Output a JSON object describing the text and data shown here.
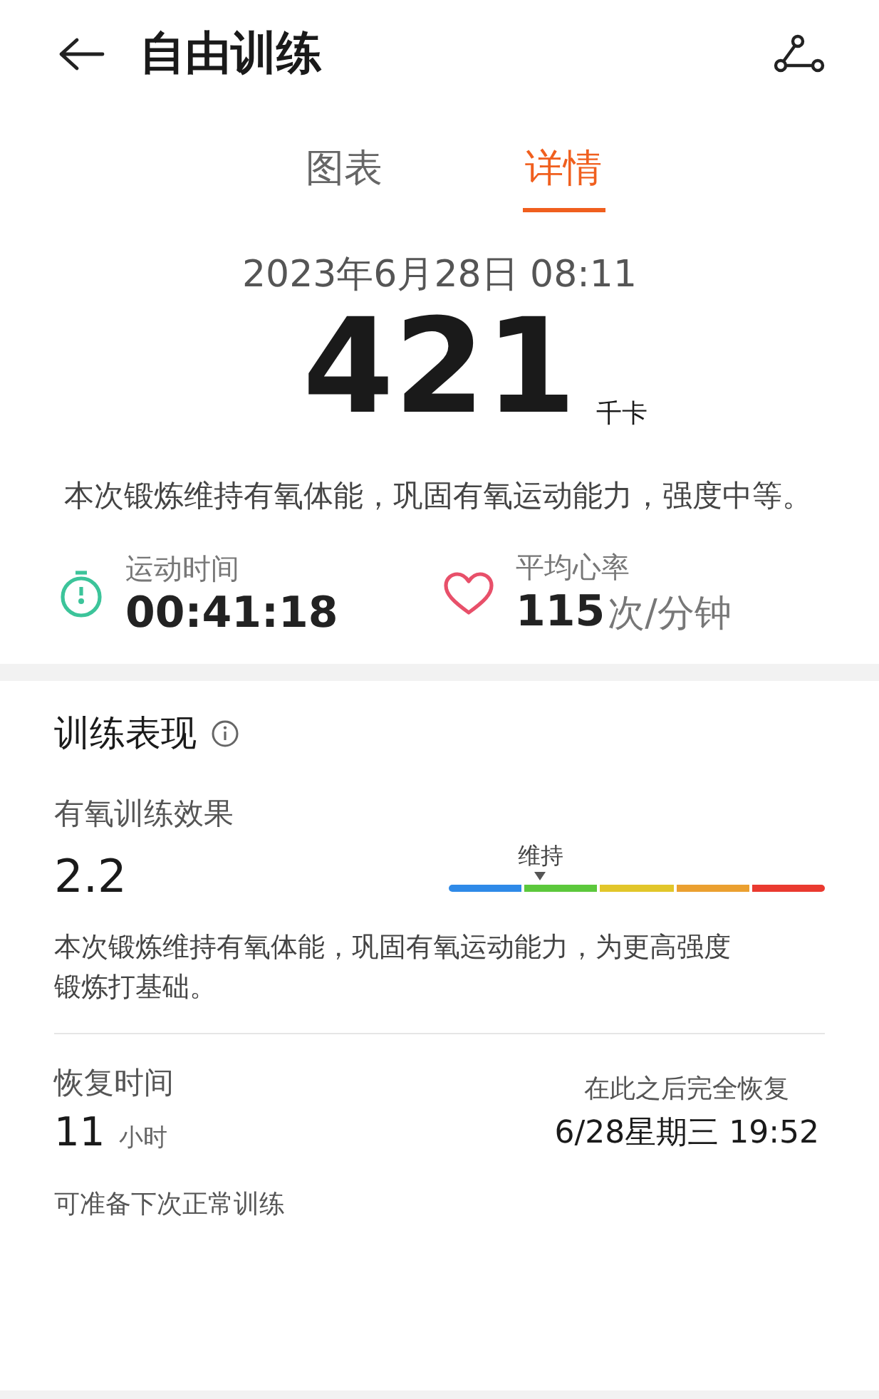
{
  "header": {
    "title": "自由训练"
  },
  "tabs": [
    {
      "label": "图表",
      "selected": false
    },
    {
      "label": "详情",
      "selected": true
    }
  ],
  "summary": {
    "datetime": "2023年6月28日 08:11",
    "calories": "421",
    "calories_unit": "千卡",
    "description": "本次锻炼维持有氧体能，巩固有氧运动能力，强度中等。"
  },
  "stats": [
    {
      "kind": "timer",
      "label": "运动时间",
      "value": "00:41:18"
    },
    {
      "kind": "heart",
      "label": "平均心率",
      "value": "115",
      "unit": "次/分钟"
    }
  ],
  "performance": {
    "title": "训练表现",
    "effect_label": "有氧训练效果",
    "effect_value": "2.2",
    "scale_label": "维持",
    "segments": [
      {
        "color": "#2f8ae8",
        "selected": false
      },
      {
        "color": "#5cc83c",
        "selected": true
      },
      {
        "color": "#e2c62a",
        "selected": false
      },
      {
        "color": "#eba030",
        "selected": false
      },
      {
        "color": "#ea3a30",
        "selected": false
      }
    ],
    "effect_description": "本次锻炼维持有氧体能，巩固有氧运动能力，为更高强度锻炼打基础。"
  },
  "recovery": {
    "label": "恢复时间",
    "value": "11",
    "unit": "小时",
    "note": "可准备下次正常训练",
    "full_label": "在此之后完全恢复",
    "full_time": "6/28星期三 19:52"
  }
}
